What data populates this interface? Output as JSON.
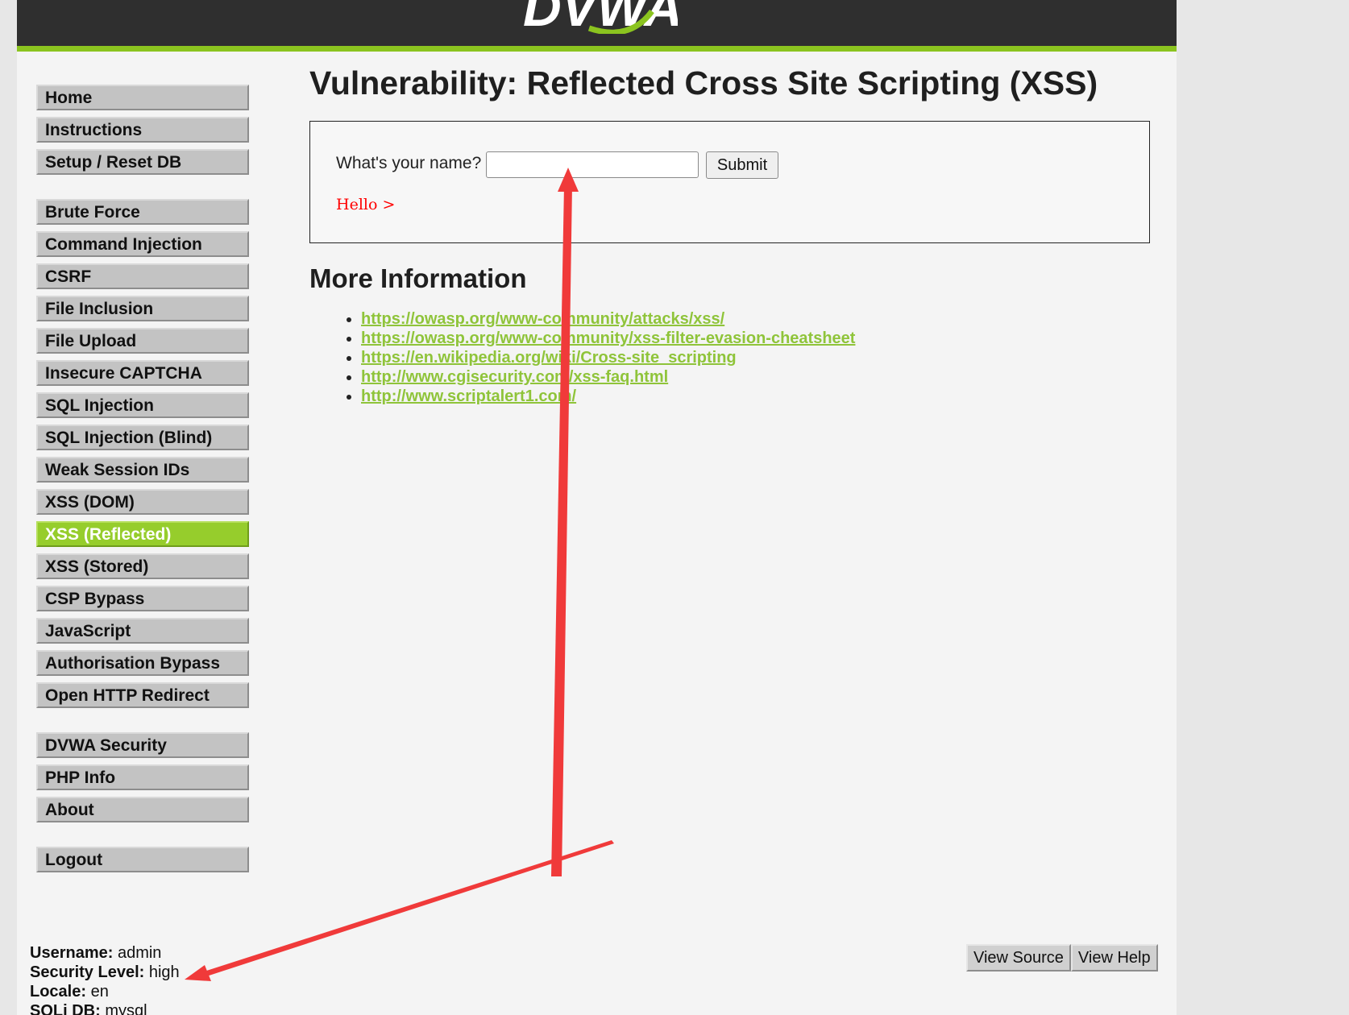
{
  "header": {
    "logo_text": "DVWA"
  },
  "menu": {
    "groups": [
      [
        {
          "label": "Home"
        },
        {
          "label": "Instructions"
        },
        {
          "label": "Setup / Reset DB"
        }
      ],
      [
        {
          "label": "Brute Force"
        },
        {
          "label": "Command Injection"
        },
        {
          "label": "CSRF"
        },
        {
          "label": "File Inclusion"
        },
        {
          "label": "File Upload"
        },
        {
          "label": "Insecure CAPTCHA"
        },
        {
          "label": "SQL Injection"
        },
        {
          "label": "SQL Injection (Blind)"
        },
        {
          "label": "Weak Session IDs"
        },
        {
          "label": "XSS (DOM)"
        },
        {
          "label": "XSS (Reflected)",
          "selected": true
        },
        {
          "label": "XSS (Stored)"
        },
        {
          "label": "CSP Bypass"
        },
        {
          "label": "JavaScript"
        },
        {
          "label": "Authorisation Bypass"
        },
        {
          "label": "Open HTTP Redirect"
        }
      ],
      [
        {
          "label": "DVWA Security"
        },
        {
          "label": "PHP Info"
        },
        {
          "label": "About"
        }
      ],
      [
        {
          "label": "Logout"
        }
      ]
    ]
  },
  "main": {
    "title": "Vulnerability: Reflected Cross Site Scripting (XSS)",
    "form": {
      "label": "What's your name?",
      "input_value": "",
      "submit_label": "Submit"
    },
    "output": "Hello >",
    "more_info_heading": "More Information",
    "links": [
      "https://owasp.org/www-community/attacks/xss/",
      "https://owasp.org/www-community/xss-filter-evasion-cheatsheet",
      "https://en.wikipedia.org/wiki/Cross-site_scripting",
      "http://www.cgisecurity.com/xss-faq.html",
      "http://www.scriptalert1.com/"
    ]
  },
  "footer": {
    "user_info": [
      {
        "key": "Username:",
        "value": "admin"
      },
      {
        "key": "Security Level:",
        "value": "high"
      },
      {
        "key": "Locale:",
        "value": "en"
      },
      {
        "key": "SQLi DB:",
        "value": "mysql"
      }
    ],
    "view_source_label": "View Source",
    "view_help_label": "View Help"
  },
  "colors": {
    "accent_green": "#8bc41f",
    "selected_menu": "#96cd2c",
    "link_green": "#8fc43a",
    "header_dark": "#2f2f2f",
    "annotation_red": "#f03a3a",
    "output_red": "#ff0000"
  },
  "icons": {
    "annotations": [
      "red-arrow-up-icon",
      "red-arrow-left-icon"
    ]
  }
}
